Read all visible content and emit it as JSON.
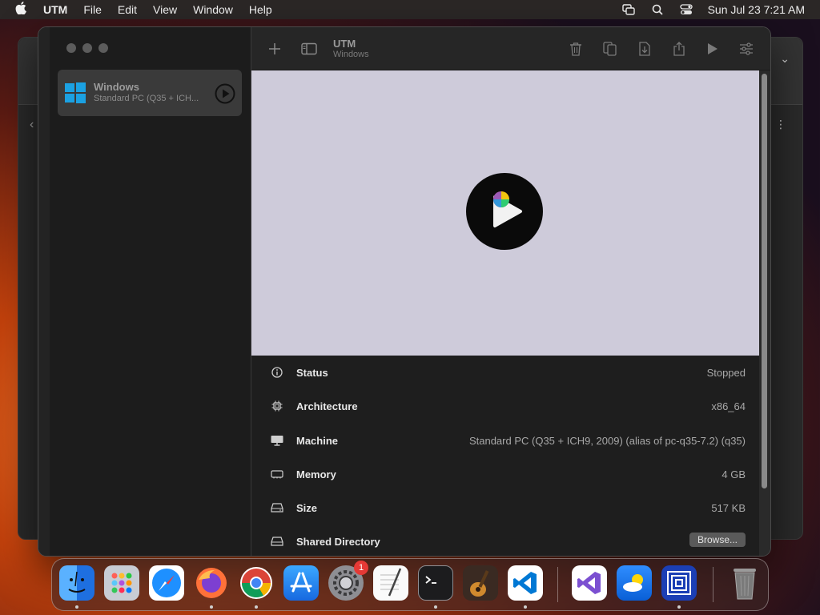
{
  "menubar": {
    "app_name": "UTM",
    "items": [
      "File",
      "Edit",
      "View",
      "Window",
      "Help"
    ],
    "clock": "Sun Jul 23  7:21 AM"
  },
  "sidebar": {
    "vms": [
      {
        "name": "Windows",
        "description": "Standard PC (Q35 + ICH..."
      }
    ]
  },
  "toolbar": {
    "title": "UTM",
    "subtitle": "Windows",
    "icons": [
      "add-icon",
      "sidebar-toggle-icon",
      "trash-icon",
      "clone-icon",
      "download-icon",
      "share-icon",
      "play-icon",
      "settings-icon"
    ]
  },
  "details": {
    "rows": [
      {
        "label": "Status",
        "value": "Stopped",
        "icon": "info-icon"
      },
      {
        "label": "Architecture",
        "value": "x86_64",
        "icon": "cpu-icon"
      },
      {
        "label": "Machine",
        "value": "Standard PC (Q35 + ICH9, 2009) (alias of pc-q35-7.2) (q35)",
        "icon": "display-icon"
      },
      {
        "label": "Memory",
        "value": "4 GB",
        "icon": "memory-icon"
      },
      {
        "label": "Size",
        "value": "517 KB",
        "icon": "drive-icon"
      },
      {
        "label": "Shared Directory",
        "value": "",
        "icon": "folder-icon",
        "button": "Browse..."
      }
    ]
  },
  "dock": {
    "apps": [
      "Finder",
      "Launchpad",
      "Safari",
      "Firefox",
      "Chrome",
      "App Store",
      "System Settings",
      "TextEdit",
      "Terminal",
      "GarageBand",
      "VS Code",
      "Visual Studio",
      "Weather",
      "UTM",
      "Trash"
    ],
    "system_settings_badge": "1"
  },
  "colors": {
    "preview_bg": "#cecbda",
    "windows_blue": "#1ba1e2"
  }
}
